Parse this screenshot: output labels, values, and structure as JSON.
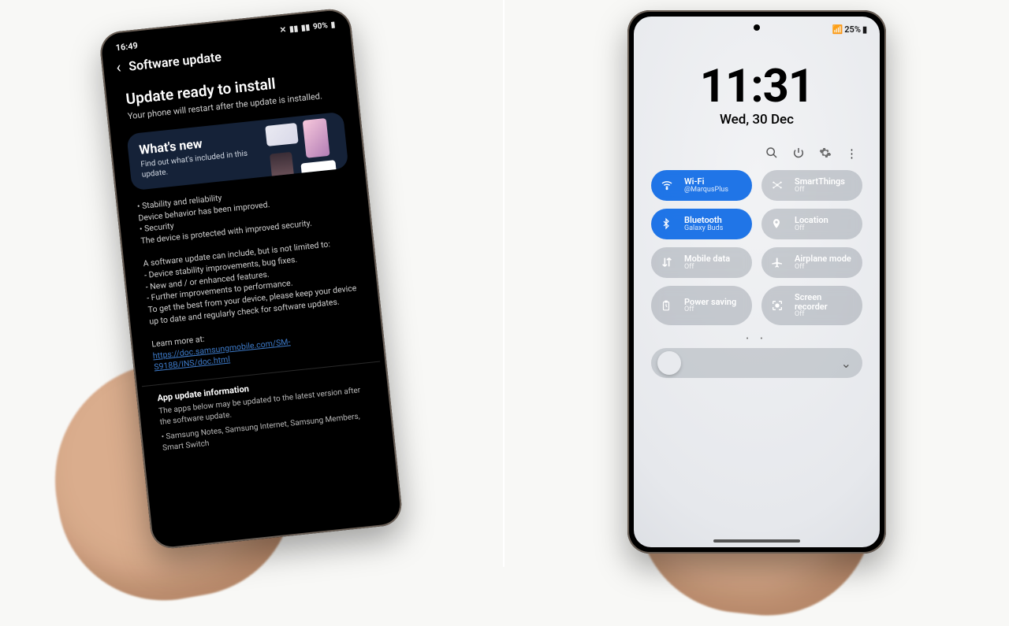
{
  "left": {
    "status": {
      "time": "16:49",
      "battery": "90%"
    },
    "header": {
      "title": "Software update"
    },
    "main": {
      "heading": "Update ready to install",
      "subheading": "Your phone will restart after the update is installed."
    },
    "whatsnew": {
      "title": "What's new",
      "caption": "Find out what's included in this update."
    },
    "notes": {
      "l1": "• Stability and reliability",
      "l2": "Device behavior has been improved.",
      "l3": "• Security",
      "l4": "The device is protected with improved security.",
      "p1": "A software update can include, but is not limited to:",
      "b1": " - Device stability improvements, bug fixes.",
      "b2": " - New and / or enhanced features.",
      "b3": " - Further improvements to performance.",
      "p2": "To get the best from your device, please keep your device up to date and regularly check for software updates.",
      "learn": "Learn more at:",
      "link": "https://doc.samsungmobile.com/SM-S918B/INS/doc.html"
    },
    "appupd": {
      "title": "App update information",
      "desc": "The apps below may be updated to the latest version after the software update.",
      "list": "• Samsung Notes, Samsung Internet, Samsung Members, Smart Switch"
    }
  },
  "right": {
    "status": {
      "battery": "25%"
    },
    "clock": {
      "time": "11:31",
      "date": "Wed, 30 Dec"
    },
    "tiles": [
      {
        "name": "Wi-Fi",
        "sub": "@MarqusPlus",
        "on": true,
        "icon": "wifi"
      },
      {
        "name": "SmartThings",
        "sub": "Off",
        "on": false,
        "icon": "smartthings"
      },
      {
        "name": "Bluetooth",
        "sub": "Galaxy Buds",
        "on": true,
        "icon": "bluetooth"
      },
      {
        "name": "Location",
        "sub": "Off",
        "on": false,
        "icon": "location"
      },
      {
        "name": "Mobile data",
        "sub": "Off",
        "on": false,
        "icon": "mobiledata"
      },
      {
        "name": "Airplane mode",
        "sub": "Off",
        "on": false,
        "icon": "airplane"
      },
      {
        "name": "Power saving",
        "sub": "Off",
        "on": false,
        "icon": "powersave"
      },
      {
        "name": "Screen recorder",
        "sub": "Off",
        "on": false,
        "icon": "screenrec"
      }
    ]
  }
}
